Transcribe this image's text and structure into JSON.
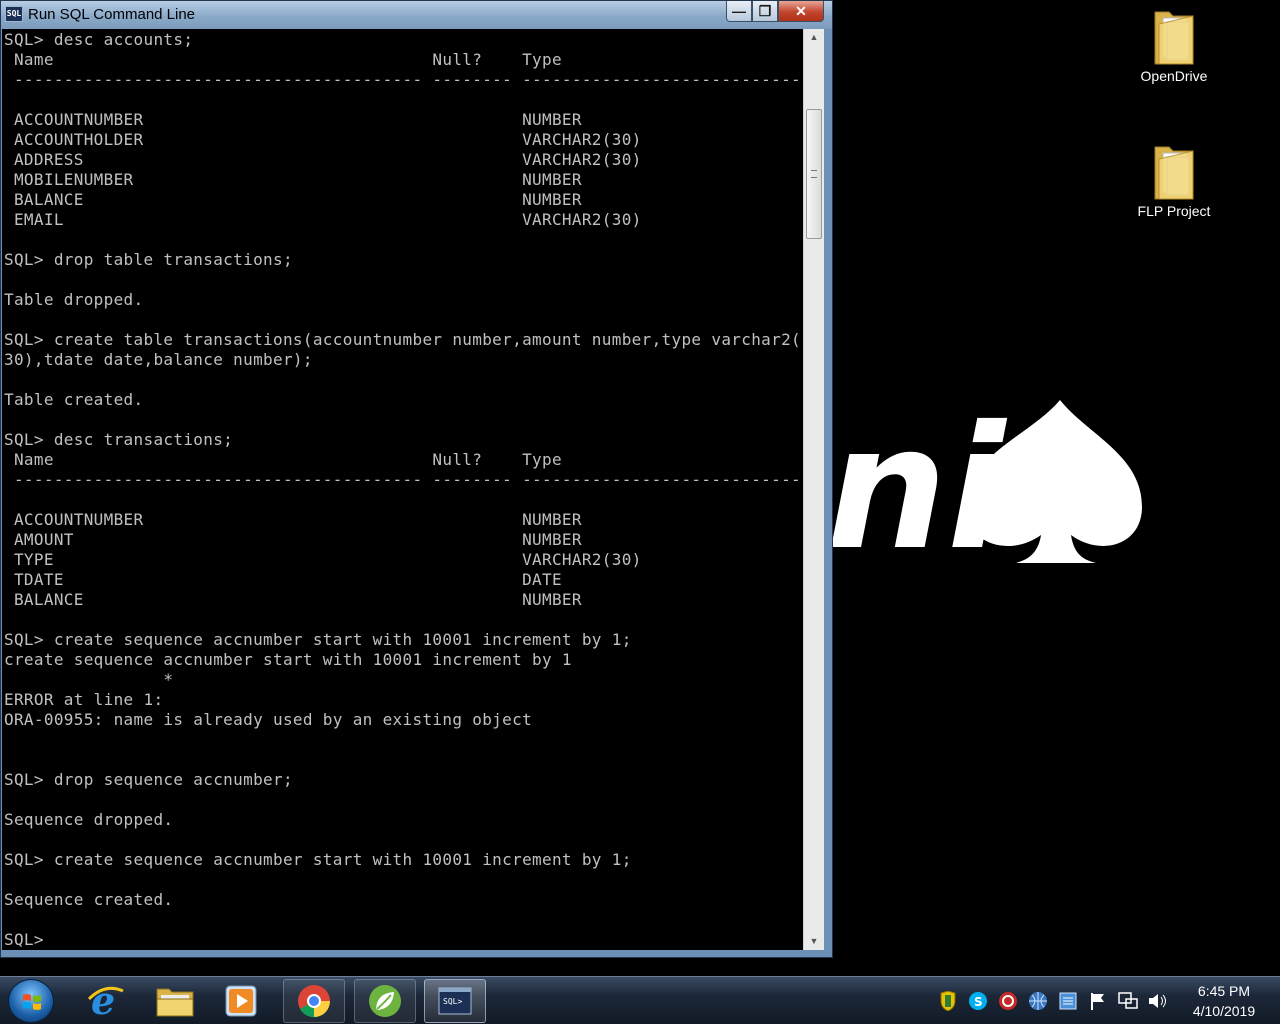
{
  "window": {
    "title": "Run SQL Command Line",
    "buttons": {
      "minimize": "—",
      "maximize": "❐",
      "close": "✕"
    }
  },
  "console": {
    "lines": [
      "SQL> desc accounts;",
      " Name                                      Null?    Type",
      " ----------------------------------------- -------- ----------------------------",
      "",
      " ACCOUNTNUMBER                                      NUMBER",
      " ACCOUNTHOLDER                                      VARCHAR2(30)",
      " ADDRESS                                            VARCHAR2(30)",
      " MOBILENUMBER                                       NUMBER",
      " BALANCE                                            NUMBER",
      " EMAIL                                              VARCHAR2(30)",
      "",
      "SQL> drop table transactions;",
      "",
      "Table dropped.",
      "",
      "SQL> create table transactions(accountnumber number,amount number,type varchar2(",
      "30),tdate date,balance number);",
      "",
      "Table created.",
      "",
      "SQL> desc transactions;",
      " Name                                      Null?    Type",
      " ----------------------------------------- -------- ----------------------------",
      "",
      " ACCOUNTNUMBER                                      NUMBER",
      " AMOUNT                                             NUMBER",
      " TYPE                                               VARCHAR2(30)",
      " TDATE                                              DATE",
      " BALANCE                                            NUMBER",
      "",
      "SQL> create sequence accnumber start with 10001 increment by 1;",
      "create sequence accnumber start with 10001 increment by 1",
      "                *",
      "ERROR at line 1:",
      "ORA-00955: name is already used by an existing object",
      "",
      "",
      "SQL> drop sequence accnumber;",
      "",
      "Sequence dropped.",
      "",
      "SQL> create sequence accnumber start with 10001 increment by 1;",
      "",
      "Sequence created.",
      "",
      "SQL>"
    ]
  },
  "desktop": {
    "icons": [
      {
        "label": "OpenDrive",
        "icon": "folder-icon"
      },
      {
        "label": "FLP Project",
        "icon": "folder-icon"
      }
    ],
    "wallpaper_text": "ni"
  },
  "taskbar": {
    "items": [
      {
        "name": "internet-explorer",
        "icon": "ie-icon"
      },
      {
        "name": "windows-explorer",
        "icon": "folder-icon"
      },
      {
        "name": "media-player",
        "icon": "media-player-icon"
      },
      {
        "name": "chrome",
        "icon": "chrome-icon"
      },
      {
        "name": "spring-tool-suite",
        "icon": "spring-leaf-icon"
      },
      {
        "name": "run-sql-command-line",
        "icon": "sql-console-icon",
        "active": true
      }
    ],
    "clock": {
      "time": "6:45 PM",
      "date": "4/10/2019"
    }
  },
  "colors": {
    "console_text": "#c0c0c0",
    "console_bg": "#000000",
    "titlebar": "#8aa9c9"
  }
}
